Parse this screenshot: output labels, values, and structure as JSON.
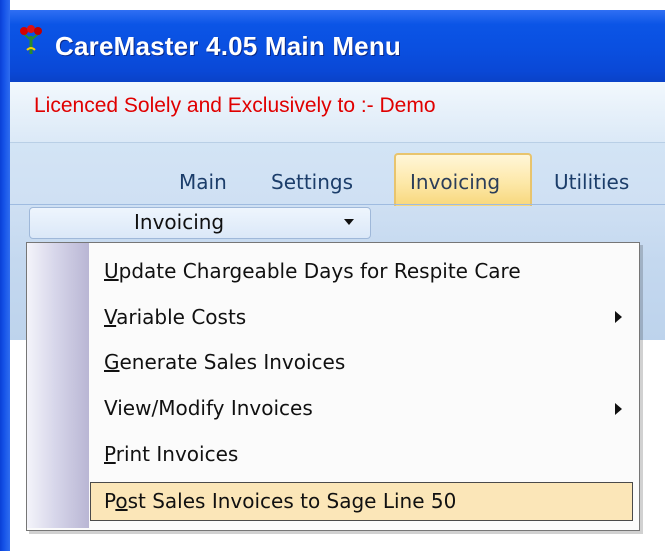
{
  "window": {
    "title": "CareMaster 4.05 Main Menu",
    "icon": "flower-app-icon"
  },
  "licence": {
    "text": "Licenced Solely and Exclusively to :-  Demo"
  },
  "ribbon": {
    "tabs": [
      {
        "label": "Main"
      },
      {
        "label": "Settings"
      },
      {
        "label": "Invoicing",
        "active": true
      },
      {
        "label": "Utilities"
      }
    ],
    "dropdown": {
      "label": "Invoicing"
    }
  },
  "menu": {
    "items": [
      {
        "first": "U",
        "rest": "pdate Chargeable Days for Respite Care",
        "submenu": false
      },
      {
        "first": "V",
        "rest": "ariable Costs",
        "submenu": true
      },
      {
        "first": "G",
        "rest": "enerate Sales Invoices",
        "submenu": false
      },
      {
        "first": "V",
        "rest": "iew/Modify Invoices",
        "submenu": true
      },
      {
        "first": "P",
        "rest": "rint Invoices",
        "submenu": false
      },
      {
        "pre": "P",
        "first": "o",
        "rest": "st Sales Invoices to Sage Line 50",
        "submenu": false,
        "selected": true
      }
    ]
  },
  "colors": {
    "titlebar": "#0a4fe0",
    "licence_text": "#e00000",
    "selected_item": "#fbe6b8",
    "active_tab": "#fde8a8"
  }
}
